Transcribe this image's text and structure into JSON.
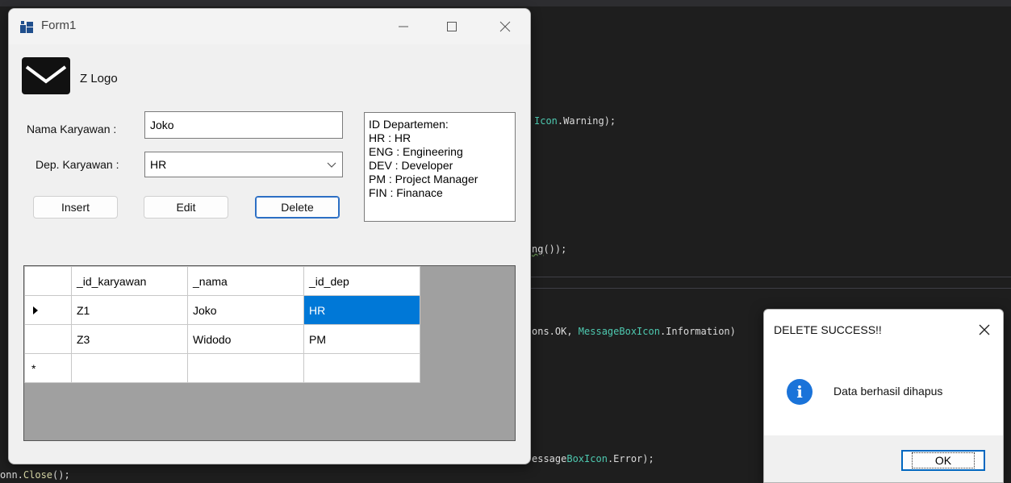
{
  "editor": {
    "lines": [
      {
        "pre": "",
        "cls": "Icon",
        "post": ".Warning);"
      },
      {
        "pre": "",
        "sq": "ng",
        "post": "());"
      },
      {
        "pre": "ons.OK, ",
        "cls": "MessageBoxIcon",
        "post": ".Information)"
      },
      {
        "pre": "essage",
        "cls": "BoxIcon",
        "post": ".Error);"
      },
      {
        "pre": "onn.",
        "mth": "Close",
        "post": "();"
      }
    ]
  },
  "window": {
    "title": "Form1"
  },
  "logo": {
    "text": "Z Logo"
  },
  "form": {
    "name_label": "Nama Karyawan :",
    "name_value": "Joko",
    "dep_label": "Dep. Karyawan :",
    "dep_value": "HR",
    "insert_label": "Insert",
    "edit_label": "Edit",
    "delete_label": "Delete"
  },
  "info_box": {
    "lines": [
      "ID Departemen:",
      "HR : HR",
      "ENG : Engineering",
      "DEV : Developer",
      "PM : Project Manager",
      "FIN : Finanace"
    ]
  },
  "grid": {
    "columns": [
      "_id_karyawan",
      "_nama",
      "_id_dep"
    ],
    "rows": [
      [
        "Z1",
        "Joko",
        "HR"
      ],
      [
        "Z3",
        "Widodo",
        "PM"
      ]
    ],
    "new_row_marker": "*"
  },
  "message_box": {
    "title": "DELETE SUCCESS!!",
    "message": "Data berhasil dihapus",
    "ok_label": "OK"
  },
  "colors": {
    "selection": "#0078d7",
    "info_icon": "#1a73d9",
    "editor_bg": "#1e1e1e"
  }
}
